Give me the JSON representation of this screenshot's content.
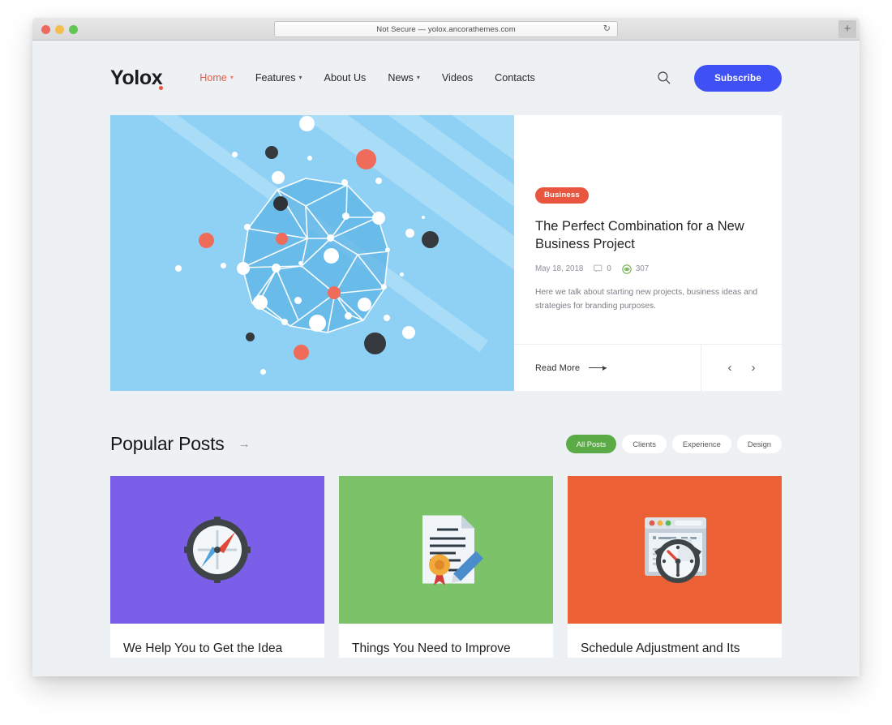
{
  "browser": {
    "url_text": "Not Secure — yolox.ancorathemes.com",
    "reload_icon": "reload-icon",
    "new_tab_label": "+"
  },
  "header": {
    "logo": "Yolox",
    "nav": [
      {
        "label": "Home",
        "has_caret": true,
        "active": true
      },
      {
        "label": "Features",
        "has_caret": true,
        "active": false
      },
      {
        "label": "About Us",
        "has_caret": false,
        "active": false
      },
      {
        "label": "News",
        "has_caret": true,
        "active": false
      },
      {
        "label": "Videos",
        "has_caret": false,
        "active": false
      },
      {
        "label": "Contacts",
        "has_caret": false,
        "active": false
      }
    ],
    "search_icon": "search-icon",
    "subscribe_label": "Subscribe"
  },
  "hero": {
    "category": "Business",
    "title": "The Perfect Combination for a New Business Project",
    "date": "May 18, 2018",
    "comments": "0",
    "views": "307",
    "excerpt": "Here we talk about starting new projects, business ideas and strategies for branding purposes.",
    "read_more": "Read More",
    "prev_icon": "‹",
    "next_icon": "›",
    "image_alt": "network-nodes-illustration"
  },
  "popular": {
    "title": "Popular Posts",
    "arrow": "→",
    "filters": [
      {
        "label": "All Posts",
        "active": true
      },
      {
        "label": "Clients",
        "active": false
      },
      {
        "label": "Experience",
        "active": false
      },
      {
        "label": "Design",
        "active": false
      }
    ],
    "cards": [
      {
        "title": "We Help You to Get the Idea",
        "icon": "compass-icon",
        "bg": "#7c5fe8"
      },
      {
        "title": "Things You Need to Improve",
        "icon": "certificate-pen-icon",
        "bg": "#7bc268"
      },
      {
        "title": "Schedule Adjustment and Its",
        "icon": "browser-stopwatch-icon",
        "bg": "#ec6036"
      }
    ]
  },
  "colors": {
    "accent_red": "#e8563f",
    "brand_blue": "#3f51f4",
    "green": "#5aaa46",
    "page_bg": "#eef1f4"
  }
}
